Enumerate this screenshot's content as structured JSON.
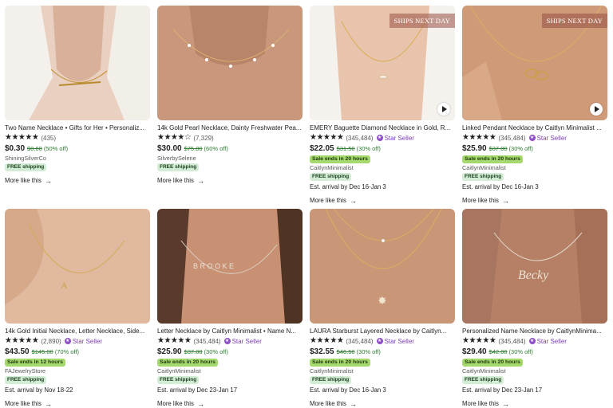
{
  "colors": {
    "star_seller": "#7b3fb3",
    "sale_badge": "#a5d86d",
    "free_shipping_badge": "#d3ecd5",
    "discount": "#2e7d32"
  },
  "products": [
    {
      "title": "Two Name Necklace • Gifts for Her • Personaliz...",
      "rating": "★★★★★",
      "reviews": "(435)",
      "star_seller": "",
      "price": "$0.30",
      "original_price": "$0.60",
      "discount": "(50% off)",
      "sale": "",
      "shop": "ShiningSilverCo",
      "shipping": "FREE shipping",
      "arrival": "",
      "more": "More like this",
      "ships_badge": "",
      "video": false
    },
    {
      "title": "14k Gold Pearl Necklace, Dainty Freshwater Pea...",
      "rating": "★★★★☆",
      "reviews": "(7,329)",
      "star_seller": "",
      "price": "$30.00",
      "original_price": "$75.00",
      "discount": "(60% off)",
      "sale": "",
      "shop": "SilverbySelene",
      "shipping": "FREE shipping",
      "arrival": "",
      "more": "More like this",
      "ships_badge": "",
      "video": false
    },
    {
      "title": "EMERY Baguette Diamond Necklace in Gold, R...",
      "rating": "★★★★★",
      "reviews": "(345,484)",
      "star_seller": "Star Seller",
      "price": "$22.05",
      "original_price": "$31.50",
      "discount": "(30% off)",
      "sale": "Sale ends in 20 hours",
      "shop": "CaitlynMinimalist",
      "shipping": "FREE shipping",
      "arrival": "Est. arrival by Dec 16-Jan 3",
      "more": "More like this",
      "ships_badge": "SHIPS NEXT DAY",
      "video": true
    },
    {
      "title": "Linked Pendant Necklace by Caitlyn Minimalist ...",
      "rating": "★★★★★",
      "reviews": "(345,484)",
      "star_seller": "Star Seller",
      "price": "$25.90",
      "original_price": "$37.00",
      "discount": "(30% off)",
      "sale": "Sale ends in 20 hours",
      "shop": "CaitlynMinimalist",
      "shipping": "FREE shipping",
      "arrival": "Est. arrival by Dec 16-Jan 3",
      "more": "More like this",
      "ships_badge": "SHIPS NEXT DAY",
      "video": true
    },
    {
      "title": "14k Gold Initial Necklace, Letter Necklace, Side...",
      "rating": "★★★★★",
      "reviews": "(2,890)",
      "star_seller": "Star Seller",
      "price": "$43.50",
      "original_price": "$145.00",
      "discount": "(70% off)",
      "sale": "Sale ends in 12 hours",
      "shop": "FAJewelryStore",
      "shipping": "FREE shipping",
      "arrival": "Est. arrival by Nov 18-22",
      "more": "More like this",
      "ships_badge": "",
      "video": false
    },
    {
      "title": "Letter Necklace by Caitlyn Minimalist • Name N...",
      "rating": "★★★★★",
      "reviews": "(345,484)",
      "star_seller": "Star Seller",
      "price": "$25.90",
      "original_price": "$37.00",
      "discount": "(30% off)",
      "sale": "Sale ends in 20 hours",
      "shop": "CaitlynMinimalist",
      "shipping": "FREE shipping",
      "arrival": "Est. arrival by Dec 23-Jan 17",
      "more": "More like this",
      "ships_badge": "",
      "video": false
    },
    {
      "title": "LAURA Starburst Layered Necklace by Caitlyn...",
      "rating": "★★★★★",
      "reviews": "(345,484)",
      "star_seller": "Star Seller",
      "price": "$32.55",
      "original_price": "$46.50",
      "discount": "(30% off)",
      "sale": "Sale ends in 20 hours",
      "shop": "CaitlynMinimalist",
      "shipping": "FREE shipping",
      "arrival": "Est. arrival by Dec 16-Jan 3",
      "more": "More like this",
      "ships_badge": "",
      "video": false
    },
    {
      "title": "Personalized Name Necklace by CaitlynMinima...",
      "rating": "★★★★★",
      "reviews": "(345,484)",
      "star_seller": "Star Seller",
      "price": "$29.40",
      "original_price": "$42.00",
      "discount": "(30% off)",
      "sale": "Sale ends in 20 hours",
      "shop": "CaitlynMinimalist",
      "shipping": "FREE shipping",
      "arrival": "Est. arrival by Dec 23-Jan 17",
      "more": "More like this",
      "ships_badge": "",
      "video": false
    }
  ]
}
